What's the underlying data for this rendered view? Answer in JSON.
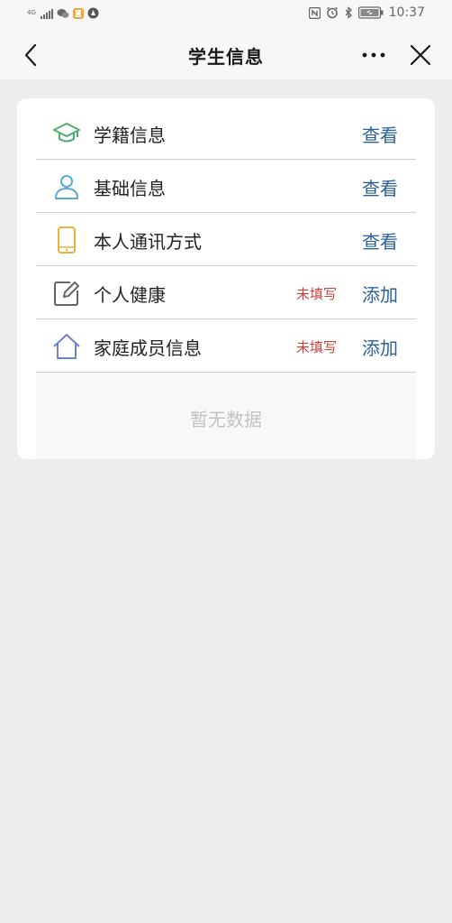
{
  "status_bar": {
    "network": "4G",
    "time": "10:37"
  },
  "nav": {
    "title": "学生信息"
  },
  "items": [
    {
      "label": "学籍信息",
      "status": "",
      "action": "查看",
      "icon": "graduation-cap-icon",
      "color": "#4cae6e"
    },
    {
      "label": "基础信息",
      "status": "",
      "action": "查看",
      "icon": "person-icon",
      "color": "#5aa9d6"
    },
    {
      "label": "本人通讯方式",
      "status": "",
      "action": "查看",
      "icon": "phone-icon",
      "color": "#e8b33a"
    },
    {
      "label": "个人健康",
      "status": "未填写",
      "action": "添加",
      "icon": "edit-icon",
      "color": "#666666"
    },
    {
      "label": "家庭成员信息",
      "status": "未填写",
      "action": "添加",
      "icon": "home-icon",
      "color": "#6d7fd1"
    }
  ],
  "empty": {
    "text": "暂无数据"
  },
  "colors": {
    "action": "#2c6199",
    "warning": "#c8413b",
    "background": "#ededed"
  }
}
